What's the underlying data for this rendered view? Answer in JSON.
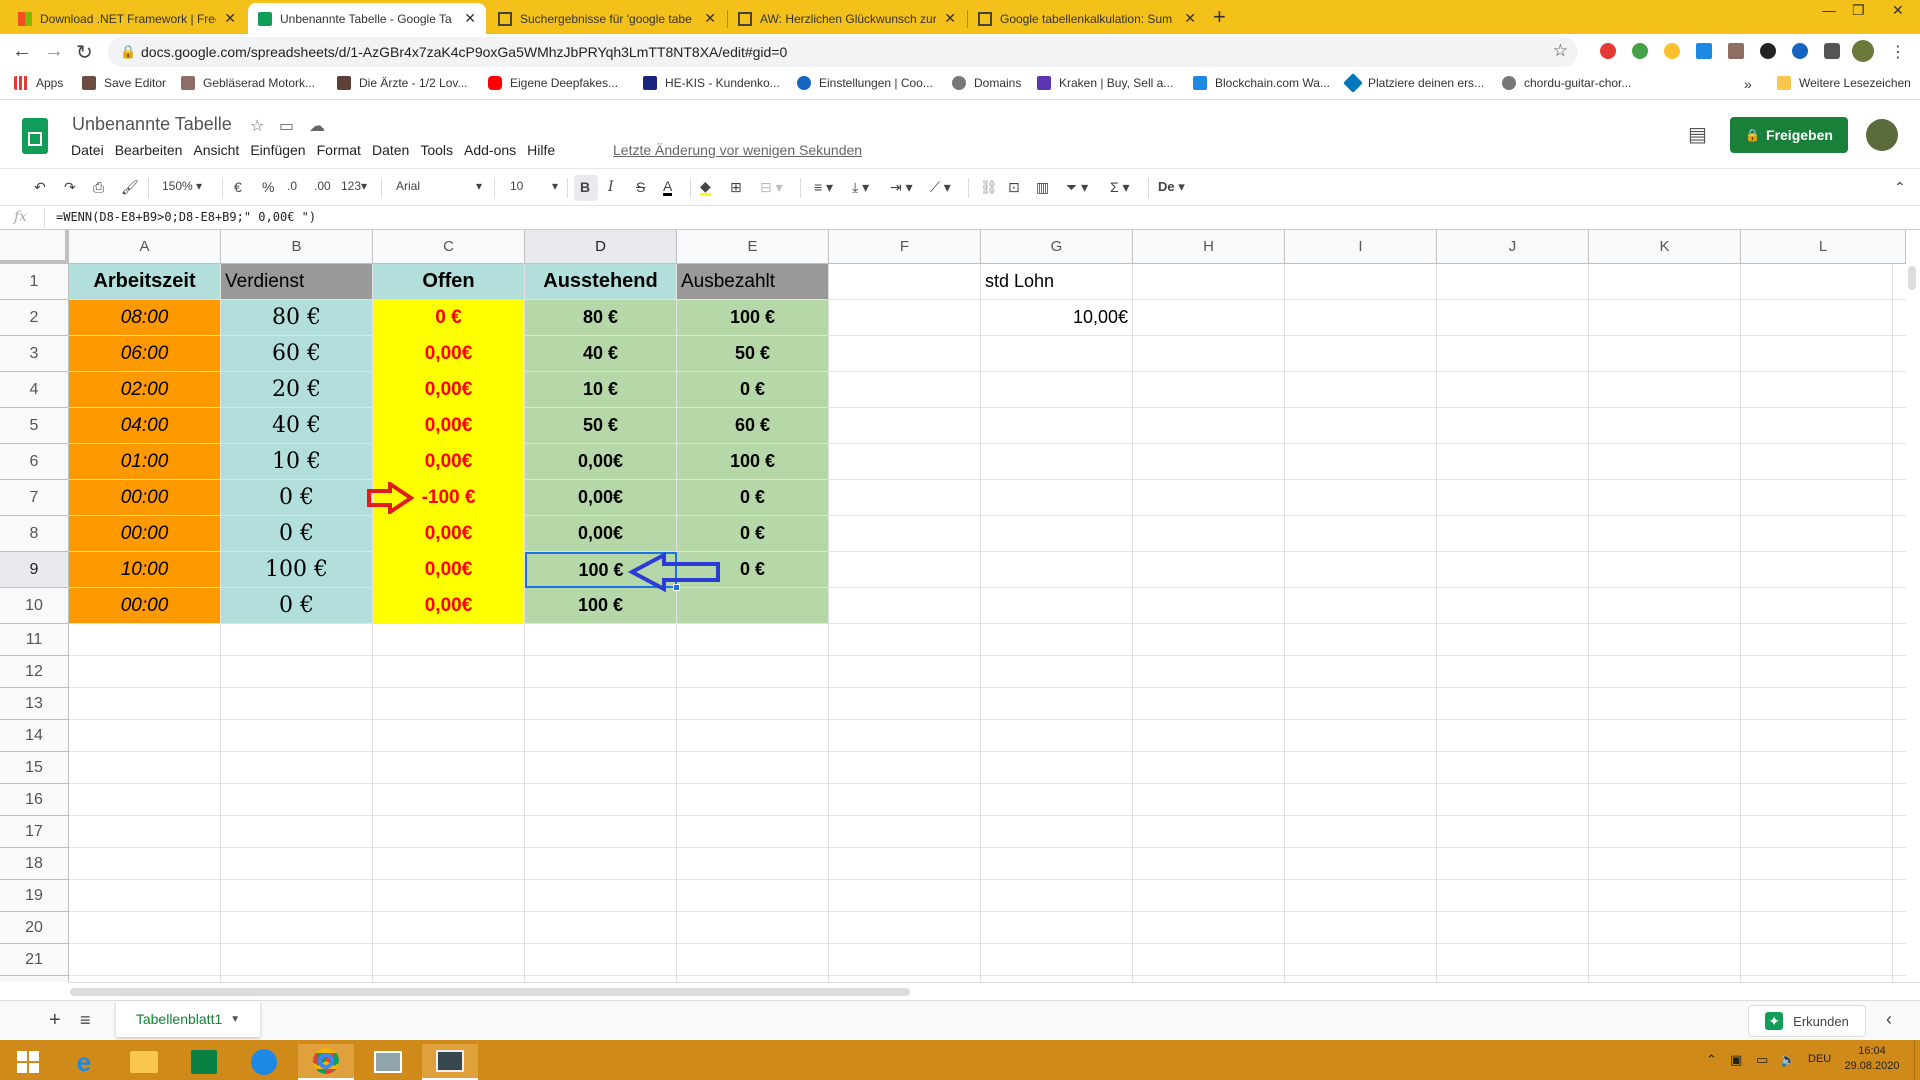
{
  "browser": {
    "tabs": [
      {
        "title": "Download .NET Framework | Free",
        "icon": "microsoft-icon",
        "active": false
      },
      {
        "title": "Unbenannte Tabelle - Google Ta",
        "icon": "sheets-icon",
        "active": true
      },
      {
        "title": "Suchergebnisse für 'google tabe",
        "icon": "doc-icon",
        "active": false
      },
      {
        "title": "AW: Herzlichen Glückwunsch zur",
        "icon": "doc-icon",
        "active": false
      },
      {
        "title": "Google tabellenkalkulation: Sum",
        "icon": "doc-icon",
        "active": false
      }
    ],
    "url": "docs.google.com/spreadsheets/d/1-AzGBr4x7zaK4cP9oxGa5WMhzJbPRYqh3LmTT8NT8XA/edit#gid=0",
    "bookmarks": [
      {
        "label": "Apps",
        "color": "#e53935"
      },
      {
        "label": "Save Editor",
        "color": "#6d4c41"
      },
      {
        "label": "Gebläserad Motork...",
        "color": "#8d6e63"
      },
      {
        "label": "Die Ärzte - 1/2 Lov...",
        "color": "#5d4037"
      },
      {
        "label": "Eigene Deepfakes...",
        "color": "#ff0000"
      },
      {
        "label": "HE-KIS - Kundenko...",
        "color": "#1a237e"
      },
      {
        "label": "Einstellungen | Coo...",
        "color": "#1565c0"
      },
      {
        "label": "Domains",
        "color": "#555555"
      },
      {
        "label": "Kraken | Buy, Sell a...",
        "color": "#5e35b1"
      },
      {
        "label": "Blockchain.com Wa...",
        "color": "#1e88e5"
      },
      {
        "label": "Platziere deinen ers...",
        "color": "#0277bd"
      },
      {
        "label": "chordu-guitar-chor...",
        "color": "#555555"
      }
    ],
    "other_bookmarks": "Weitere Lesezeichen",
    "more_bookmarks": "»"
  },
  "sheets": {
    "title": "Unbenannte Tabelle",
    "menu": [
      "Datei",
      "Bearbeiten",
      "Ansicht",
      "Einfügen",
      "Format",
      "Daten",
      "Tools",
      "Add-ons",
      "Hilfe"
    ],
    "last_edit": "Letzte Änderung vor wenigen Sekunden",
    "share_label": "Freigeben",
    "toolbar": {
      "zoom": "150%",
      "currency": "€",
      "percent": "%",
      "dec_less": ".0",
      "dec_more": ".00",
      "number_format": "123",
      "font": "Arial",
      "font_size": "10",
      "bold": "B",
      "italic": "I",
      "strike": "S",
      "text_color": "A",
      "sum": "Σ",
      "input_tools": "De"
    },
    "formula": {
      "label": "fx",
      "text": "=WENN(D8-E8+B9>0;D8-E8+B9;\" 0,00€ \")"
    },
    "columns": [
      "A",
      "B",
      "C",
      "D",
      "E",
      "F",
      "G",
      "H",
      "I",
      "J",
      "K",
      "L"
    ],
    "rows": [
      "1",
      "2",
      "3",
      "4",
      "5",
      "6",
      "7",
      "8",
      "9",
      "10",
      "11",
      "12",
      "13",
      "14",
      "15",
      "16",
      "17",
      "18",
      "19",
      "20",
      "21"
    ],
    "cells": {
      "A": [
        "Arbeitszeit",
        "08:00",
        "06:00",
        "02:00",
        "04:00",
        "01:00",
        "00:00",
        "00:00",
        "10:00",
        "00:00"
      ],
      "B": [
        "Verdienst",
        "80 €",
        "60 €",
        "20 €",
        "40 €",
        "10 €",
        "0 €",
        "0 €",
        "100 €",
        "0 €"
      ],
      "C": [
        "Offen",
        "0 €",
        "0,00€",
        "0,00€",
        "0,00€",
        "0,00€",
        "-100 €",
        "0,00€",
        "0,00€",
        "0,00€"
      ],
      "D": [
        "Ausstehend",
        "80 €",
        "40 €",
        "10 €",
        "50 €",
        "0,00€",
        "0,00€",
        "0,00€",
        "100 €",
        "100 €"
      ],
      "E": [
        "Ausbezahlt",
        "100 €",
        "50 €",
        "0 €",
        "60 €",
        "100 €",
        "0 €",
        "0 €",
        "0 €",
        ""
      ],
      "G": [
        "std Lohn",
        "10,00€"
      ]
    },
    "colors": {
      "orange": "#ff9900",
      "teal": "#b2dfdb",
      "gray": "#999999",
      "yellow": "#ffff00",
      "green": "#b6d7a8",
      "red_text": "#ff0000",
      "red_arrow": "#e11c1c",
      "blue_arrow": "#2a3bd6",
      "selection": "#1a73e8"
    },
    "sheet_tab": "Tabellenblatt1",
    "explore_label": "Erkunden"
  },
  "taskbar": {
    "language": "DEU",
    "time": "16:04",
    "date": "29.08.2020"
  }
}
